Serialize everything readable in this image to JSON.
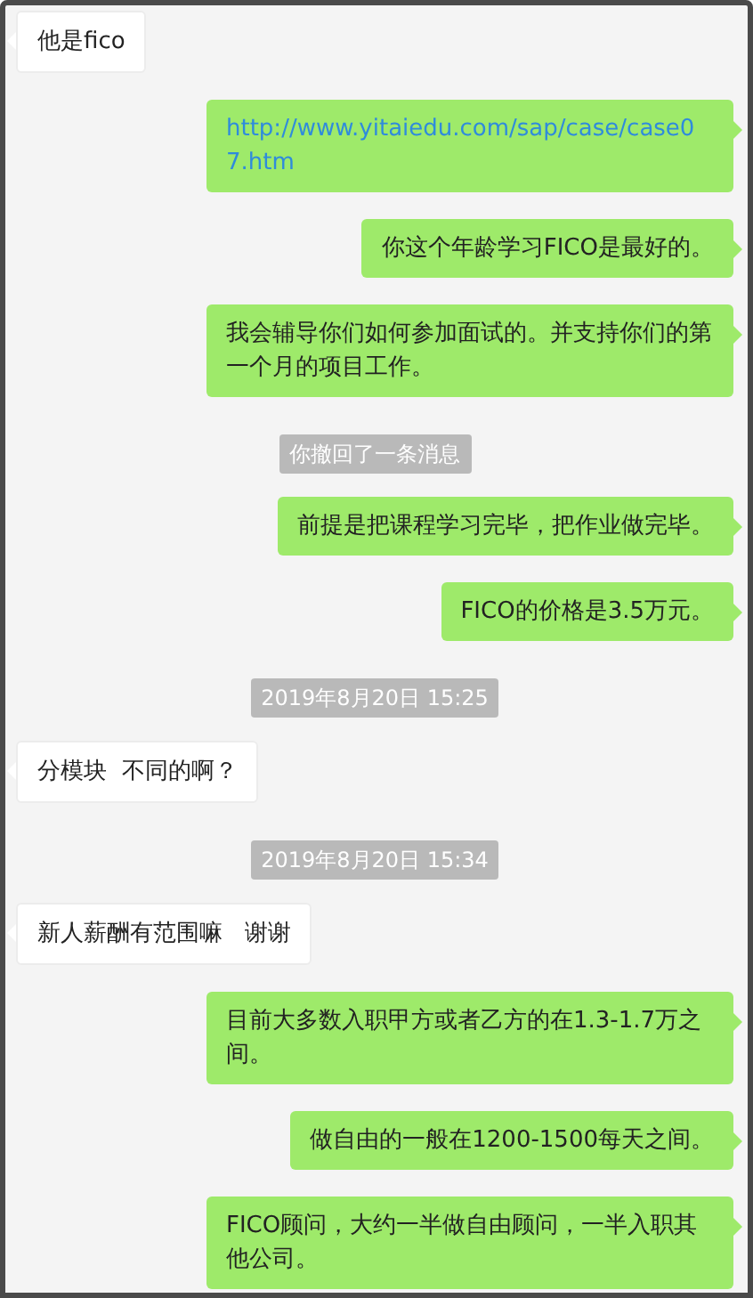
{
  "messages": [
    {
      "kind": "in",
      "text": "他是fico"
    },
    {
      "kind": "link",
      "text": "http://www.yitaiedu.com/sap/case/case07.htm"
    },
    {
      "kind": "out",
      "text": "你这个年龄学习FICO是最好的。"
    },
    {
      "kind": "out",
      "text": "我会辅导你们如何参加面试的。并支持你们的第一个月的项目工作。"
    },
    {
      "kind": "system",
      "text": "你撤回了一条消息"
    },
    {
      "kind": "out",
      "text": "前提是把课程学习完毕，把作业做完毕。"
    },
    {
      "kind": "out",
      "text": "FICO的价格是3.5万元。"
    },
    {
      "kind": "system",
      "text": "2019年8月20日 15:25"
    },
    {
      "kind": "in",
      "text": "分模块  不同的啊？"
    },
    {
      "kind": "system",
      "text": "2019年8月20日 15:34"
    },
    {
      "kind": "in",
      "text": "新人薪酬有范围嘛   谢谢"
    },
    {
      "kind": "out",
      "text": "目前大多数入职甲方或者乙方的在1.3-1.7万之间。"
    },
    {
      "kind": "out",
      "text": "做自由的一般在1200-1500每天之间。"
    },
    {
      "kind": "out",
      "text": "FICO顾问，大约一半做自由顾问，一半入职其他公司。"
    }
  ]
}
